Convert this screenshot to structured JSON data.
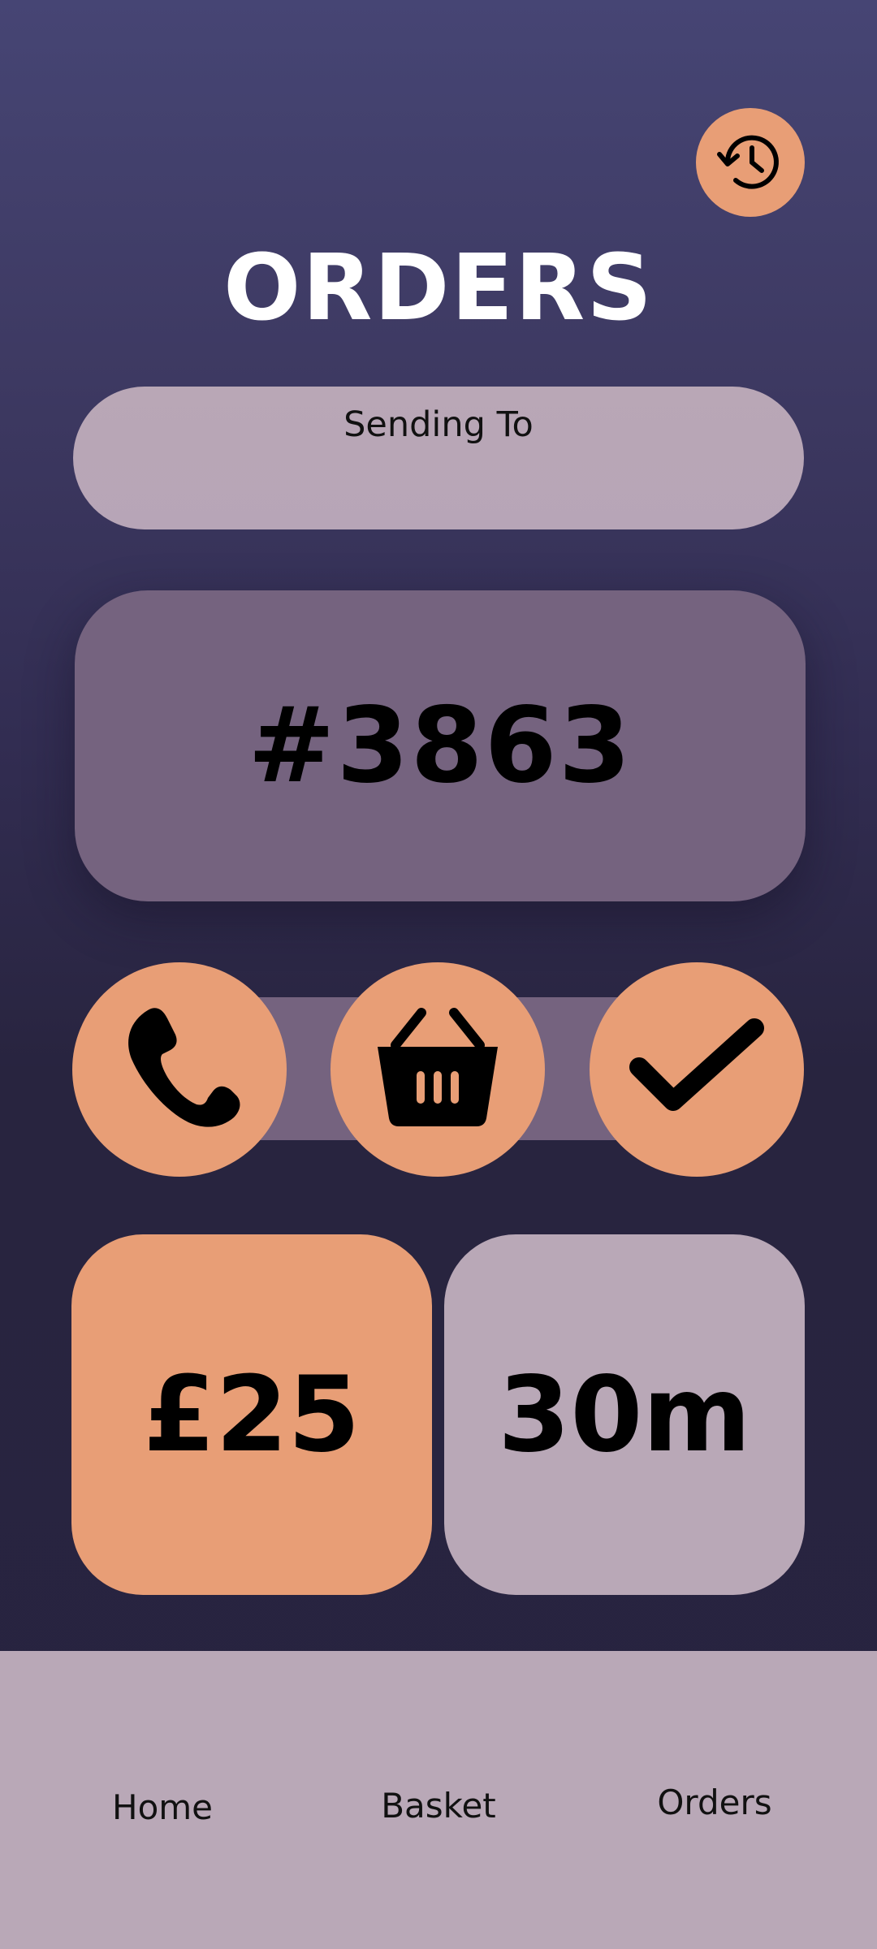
{
  "header": {
    "title": "ORDERS",
    "history_icon": "history-icon"
  },
  "sending": {
    "label": "Sending To",
    "value": ""
  },
  "order": {
    "number": "#3863"
  },
  "status_steps": [
    {
      "icon": "phone-icon"
    },
    {
      "icon": "basket-icon"
    },
    {
      "icon": "check-icon"
    }
  ],
  "summary": {
    "price": "£25",
    "time": "30m"
  },
  "nav": {
    "items": [
      {
        "label": "Home"
      },
      {
        "label": "Basket"
      },
      {
        "label": "Orders"
      }
    ]
  },
  "colors": {
    "accent": "#e89e76",
    "card": "#75637f",
    "panel": "#b9a8b7",
    "background_top": "#464574",
    "background_bottom": "#272340"
  }
}
